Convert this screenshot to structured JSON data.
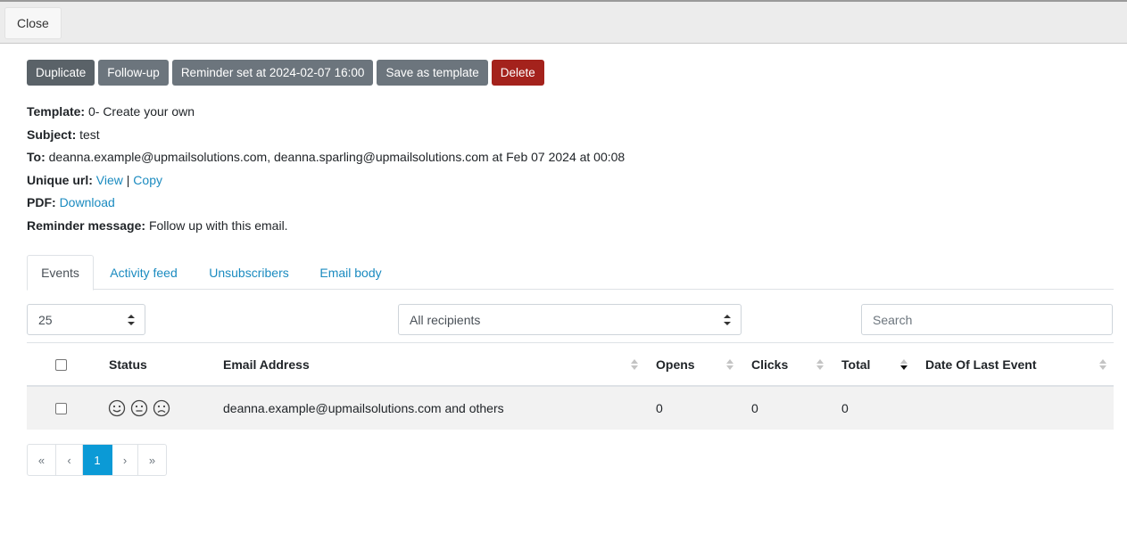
{
  "topbar": {
    "close_label": "Close"
  },
  "actions": {
    "duplicate": "Duplicate",
    "follow_up": "Follow-up",
    "reminder": "Reminder set at 2024-02-07 16:00",
    "save_template": "Save as template",
    "delete": "Delete",
    "colors": {
      "dark": "#5a6268",
      "grey": "#6c757d",
      "danger": "#a4221c"
    }
  },
  "info": {
    "template_label": "Template:",
    "template_value": "0- Create your own",
    "subject_label": "Subject:",
    "subject_value": "test",
    "to_label": "To:",
    "to_value": "deanna.example@upmailsolutions.com, deanna.sparling@upmailsolutions.com at Feb 07 2024 at 00:08",
    "unique_url_label": "Unique url:",
    "view_link": "View",
    "separator": "|",
    "copy_link": "Copy",
    "pdf_label": "PDF:",
    "download_link": "Download",
    "reminder_label": "Reminder message:",
    "reminder_value": "Follow up with this email."
  },
  "tabs": [
    {
      "label": "Events",
      "active": true
    },
    {
      "label": "Activity feed",
      "active": false
    },
    {
      "label": "Unsubscribers",
      "active": false
    },
    {
      "label": "Email body",
      "active": false
    }
  ],
  "controls": {
    "page_size": "25",
    "recipients_filter": "All recipients",
    "search_placeholder": "Search"
  },
  "table": {
    "columns": [
      "Status",
      "Email Address",
      "Opens",
      "Clicks",
      "Total",
      "Date Of Last Event"
    ],
    "rows": [
      {
        "status_icons": [
          "smile-icon",
          "neutral-face-icon",
          "frown-icon"
        ],
        "email": "deanna.example@upmailsolutions.com and others",
        "opens": "0",
        "clicks": "0",
        "total": "0",
        "last_event": ""
      }
    ]
  },
  "pagination": {
    "first": "«",
    "prev": "‹",
    "current": "1",
    "next": "›",
    "last": "»",
    "accent": "#0b9ad6"
  },
  "link_color": "#1b8bc0"
}
